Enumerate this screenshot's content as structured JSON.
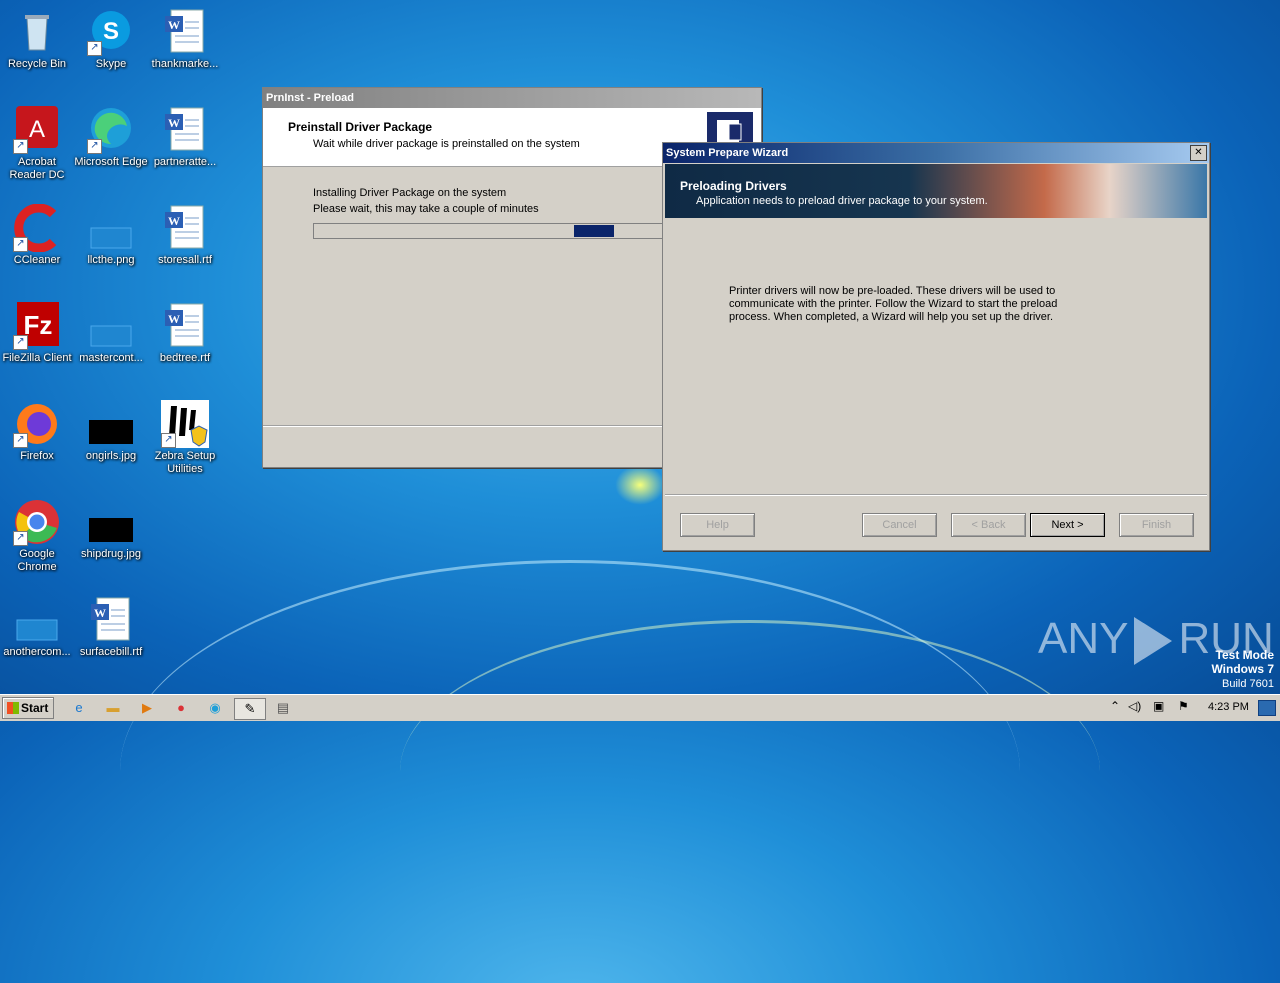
{
  "desktop": {
    "icons": [
      {
        "label": "Recycle Bin"
      },
      {
        "label": "Skype"
      },
      {
        "label": "thankmarke..."
      },
      {
        "label": "Acrobat Reader DC"
      },
      {
        "label": "Microsoft Edge"
      },
      {
        "label": "partneratte..."
      },
      {
        "label": "CCleaner"
      },
      {
        "label": "llcthe.png"
      },
      {
        "label": "storesall.rtf"
      },
      {
        "label": "FileZilla Client"
      },
      {
        "label": "mastercont..."
      },
      {
        "label": "bedtree.rtf"
      },
      {
        "label": "Firefox"
      },
      {
        "label": "ongirls.jpg"
      },
      {
        "label": "Zebra Setup Utilities"
      },
      {
        "label": "Google Chrome"
      },
      {
        "label": "shipdrug.jpg"
      },
      {
        "label": "anothercom..."
      },
      {
        "label": "surfacebill.rtf"
      }
    ]
  },
  "prninst": {
    "title": "PrnInst - Preload",
    "header_title": "Preinstall Driver Package",
    "header_sub": "Wait while driver package is preinstalled on the system",
    "line1": "Installing Driver Package on the system",
    "line2": "Please wait, this may take a couple of minutes",
    "progress_fraction": 0.13
  },
  "wizard": {
    "title": "System Prepare Wizard",
    "close_glyph": "✕",
    "banner_title": "Preloading Drivers",
    "banner_sub": "Application needs to preload driver package to your system.",
    "body": "Printer drivers will now be pre-loaded. These drivers will be used to communicate with the printer. Follow the Wizard to start the preload process. When completed, a Wizard will help you set up the driver.",
    "buttons": {
      "help": "Help",
      "cancel": "Cancel",
      "back": "< Back",
      "next": "Next >",
      "finish": "Finish"
    }
  },
  "watermark": {
    "brand_left": "ANY",
    "brand_right": "RUN",
    "line1": "Test Mode",
    "line2": "Windows 7",
    "line3": "Build 7601"
  },
  "taskbar": {
    "start_label": "Start",
    "time": "4:23 PM",
    "tray_up": "⌃"
  }
}
